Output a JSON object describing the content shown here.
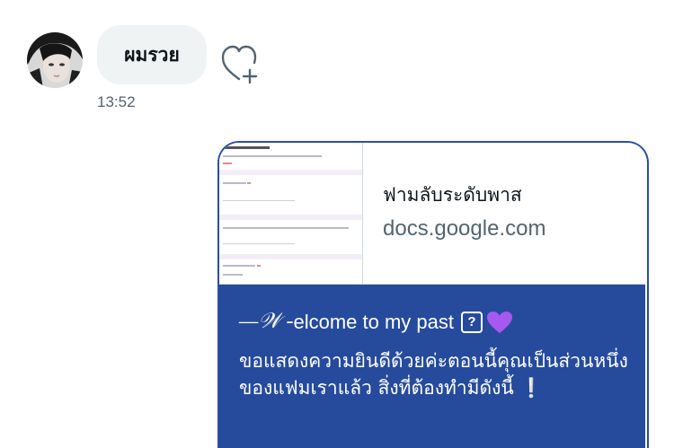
{
  "incoming": {
    "text": "ผมรวย",
    "time": "13:52"
  },
  "outgoing_card": {
    "link_title": "ฟามลับระดับพาส",
    "link_domain": "docs.google.com",
    "message_line1_prefix": "—𝒲 -",
    "message_line1_text": "elcome to my past",
    "question_box": "?",
    "heart_emoji": "💜",
    "message_body": "ขอแสดงความยินดีด้วยค่ะตอนนี้คุณเป็นส่วนหนึ่งของแฟมเราแล้ว สิ่งที่ต้องทำมีดังนี้",
    "exclamation": "❕"
  },
  "icons": {
    "avatar": "avatar-photo",
    "react": "heart-plus-icon",
    "heart_color": "#a659f0"
  },
  "colors": {
    "bubble_in": "#eff3f4",
    "card_body": "#264b9c",
    "time_text": "#536471"
  }
}
